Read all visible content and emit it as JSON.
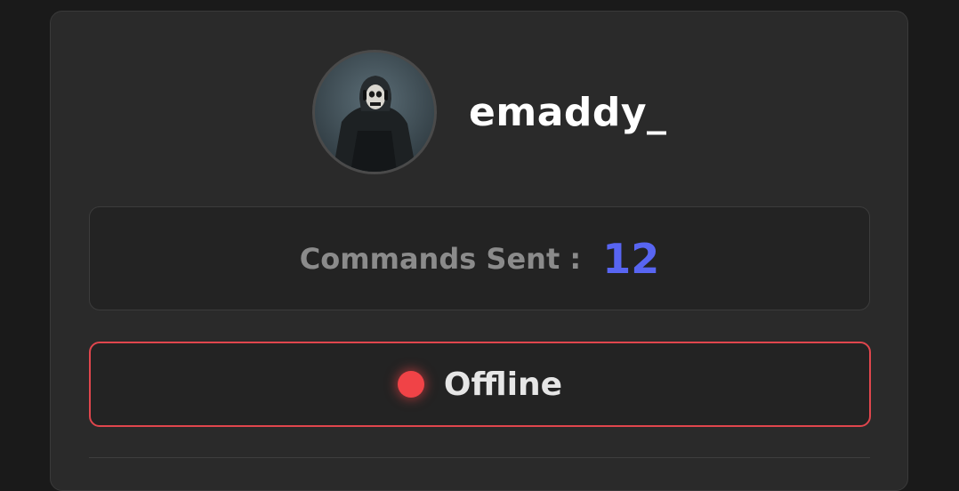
{
  "user": {
    "username": "emaddy_",
    "avatar_icon": "masked-soldier-avatar"
  },
  "stats": {
    "label": "Commands Sent :",
    "value": "12",
    "value_color": "#5865f2"
  },
  "status": {
    "text": "Offline",
    "dot_color": "#f04347",
    "border_color": "#e0464d"
  },
  "colors": {
    "background": "#1a1a1a",
    "card": "#2a2a2a"
  }
}
